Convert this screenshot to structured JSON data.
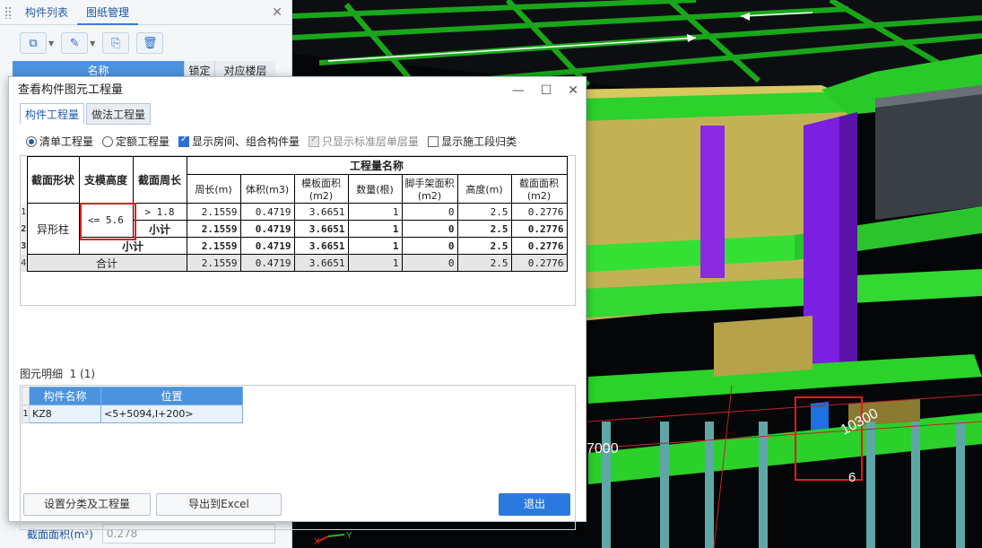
{
  "left_panel": {
    "tabs": [
      "构件列表",
      "图纸管理"
    ],
    "header": {
      "name": "名称",
      "lock": "锁定",
      "floor": "对应楼层"
    },
    "property": {
      "label": "截面面积(m²)",
      "value": "0.278"
    }
  },
  "dialog": {
    "title": "查看构件图元工程量",
    "tabs": [
      "构件工程量",
      "做法工程量"
    ],
    "options": [
      {
        "label": "清单工程量",
        "kind": "radio",
        "state": "on"
      },
      {
        "label": "定额工程量",
        "kind": "radio",
        "state": "off"
      },
      {
        "label": "显示房间、组合构件量",
        "kind": "check",
        "state": "on"
      },
      {
        "label": "只显示标准层单层量",
        "kind": "check",
        "state": "disabled"
      },
      {
        "label": "显示施工段归类",
        "kind": "check",
        "state": "off"
      }
    ],
    "table": {
      "group_header": "工程量名称",
      "headers": {
        "shape": "截面形状",
        "height": "支模高度",
        "perimeter": "截面周长",
        "zhouchang": "周长(m)",
        "tiji": "体积(m3)",
        "mianji": "模板面积(m2)",
        "shuliang": "数量(根)",
        "jiaoshou": "脚手架面积(m2)",
        "gaodu": "高度(m)",
        "jiemian": "截面面积(m2)"
      },
      "shape_value": "异形柱",
      "height_value": "<= 5.6",
      "rows": [
        {
          "num": "1",
          "label": "> 1.8",
          "values": [
            "2.1559",
            "0.4719",
            "3.6651",
            "1",
            "0",
            "2.5",
            "0.2776"
          ]
        },
        {
          "num": "2",
          "label": "小计",
          "values": [
            "2.1559",
            "0.4719",
            "3.6651",
            "1",
            "0",
            "2.5",
            "0.2776"
          ]
        },
        {
          "num": "3",
          "label": "小计",
          "values": [
            "2.1559",
            "0.4719",
            "3.6651",
            "1",
            "0",
            "2.5",
            "0.2776"
          ]
        },
        {
          "num": "4",
          "label": "合计",
          "values": [
            "2.1559",
            "0.4719",
            "3.6651",
            "1",
            "0",
            "2.5",
            "0.2776"
          ]
        }
      ]
    },
    "detail": {
      "label": "图元明细",
      "count": "1 (1)",
      "headers": [
        "构件名称",
        "位置"
      ],
      "rows": [
        {
          "num": "1",
          "name": "KZ8",
          "position": "<5+5094,I+200>"
        }
      ]
    },
    "buttons": {
      "set_class": "设置分类及工程量",
      "export": "导出到Excel",
      "exit": "退出"
    }
  },
  "viewport": {
    "dim_label_1": "10300",
    "dim_label_2": "7000",
    "axis_label": "6",
    "axis_x": "X",
    "axis_y": "Y"
  }
}
